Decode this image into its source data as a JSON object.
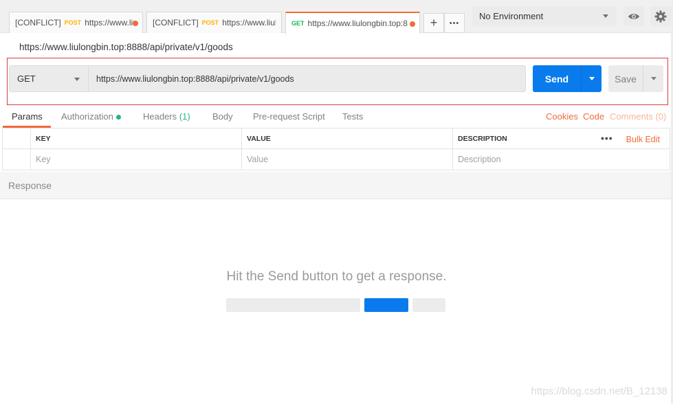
{
  "tabs": [
    {
      "conflict": "[CONFLICT]",
      "method": "POST",
      "url": "https://www.liu"
    },
    {
      "conflict": "[CONFLICT]",
      "method": "POST",
      "url": "https://www.liulon"
    },
    {
      "conflict": "",
      "method": "GET",
      "url": "https://www.liulongbin.top:8"
    }
  ],
  "tab_actions": {
    "add": "+",
    "more": "•••"
  },
  "environment": {
    "selected": "No Environment"
  },
  "request": {
    "title": "https://www.liulongbin.top:8888/api/private/v1/goods",
    "method": "GET",
    "url": "https://www.liulongbin.top:8888/api/private/v1/goods",
    "send_label": "Send",
    "save_label": "Save"
  },
  "subtabs": {
    "params": "Params",
    "authorization": "Authorization",
    "headers": "Headers",
    "headers_count": "(1)",
    "body": "Body",
    "prerequest": "Pre-request Script",
    "tests": "Tests",
    "cookies": "Cookies",
    "code": "Code",
    "comments": "Comments (0)"
  },
  "params_table": {
    "headers": [
      "KEY",
      "VALUE",
      "DESCRIPTION"
    ],
    "more": "•••",
    "bulk_edit": "Bulk Edit",
    "placeholders": {
      "key": "Key",
      "value": "Value",
      "description": "Description"
    }
  },
  "response": {
    "label": "Response",
    "hint": "Hit the Send button to get a response."
  },
  "watermark": "https://blog.csdn.net/B_12138",
  "colors": {
    "accent": "#f26b3a",
    "primary": "#097bed",
    "success": "#26b47f",
    "post": "#ffb400",
    "get": "#0cbb52"
  }
}
